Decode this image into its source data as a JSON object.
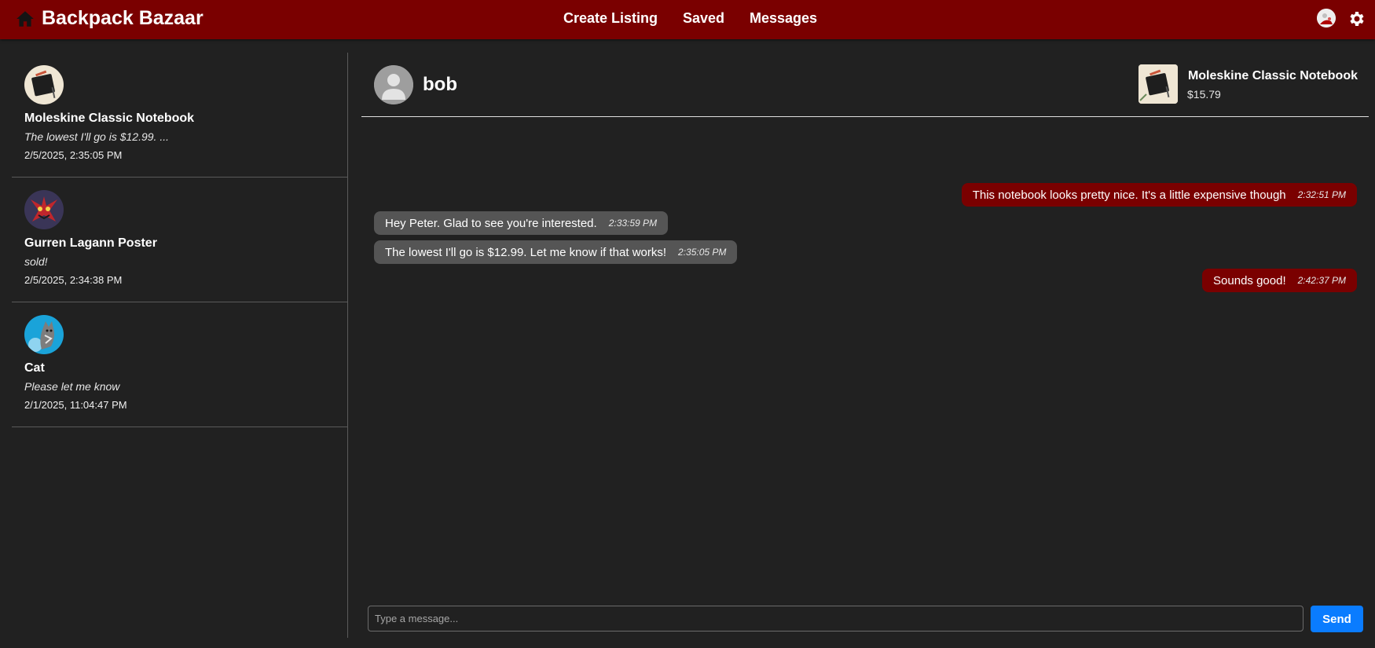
{
  "header": {
    "brand": "Backpack Bazaar",
    "nav": {
      "create_listing": "Create Listing",
      "saved": "Saved",
      "messages": "Messages"
    },
    "icons": [
      "home-icon",
      "user-avatar",
      "gear-icon"
    ]
  },
  "conversations": [
    {
      "title": "Moleskine Classic Notebook",
      "preview": "The lowest I'll go is $12.99. ...",
      "time": "2/5/2025, 2:35:05 PM",
      "thumb": "notebook"
    },
    {
      "title": "Gurren Lagann Poster",
      "preview": "sold!",
      "time": "2/5/2025, 2:34:38 PM",
      "thumb": "poster"
    },
    {
      "title": "Cat",
      "preview": "Please let me know",
      "time": "2/1/2025, 11:04:47 PM",
      "thumb": "cat"
    }
  ],
  "chat": {
    "partner_name": "bob",
    "listing": {
      "title": "Moleskine Classic Notebook",
      "price": "$15.79"
    },
    "messages": [
      {
        "direction": "sent",
        "text": "This notebook looks pretty nice. It's a little expensive though",
        "time": "2:32:51 PM"
      },
      {
        "direction": "received",
        "text": "Hey Peter. Glad to see you're interested.",
        "time": "2:33:59 PM"
      },
      {
        "direction": "received",
        "text": "The lowest I'll go is $12.99. Let me know if that works!",
        "time": "2:35:05 PM"
      },
      {
        "direction": "sent",
        "text": "Sounds good!",
        "time": "2:42:37 PM"
      }
    ]
  },
  "composer": {
    "placeholder": "Type a message...",
    "value": "",
    "send_label": "Send"
  },
  "colors": {
    "header_bg": "#7a0000",
    "page_bg": "#212121",
    "sent_bubble": "#7a0000",
    "received_bubble": "#555555",
    "send_button": "#0a7cff"
  }
}
